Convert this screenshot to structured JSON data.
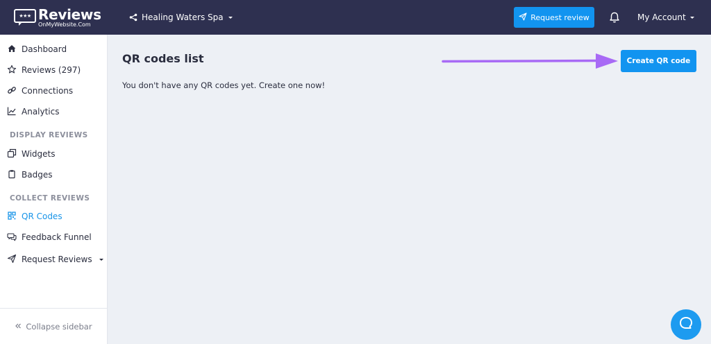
{
  "brand": {
    "title": "Reviews",
    "subtitle": "OnMyWebsite.Com",
    "badge_text": "★★★"
  },
  "header": {
    "location_name": "Healing Waters Spa",
    "request_review_label": "Request review",
    "account_label": "My Account"
  },
  "sidebar": {
    "items": [
      {
        "label": "Dashboard",
        "icon": "home-icon"
      },
      {
        "label": "Reviews (297)",
        "icon": "star-icon"
      },
      {
        "label": "Connections",
        "icon": "link-icon"
      },
      {
        "label": "Analytics",
        "icon": "chart-icon"
      }
    ],
    "display_section": "DISPLAY REVIEWS",
    "display_items": [
      {
        "label": "Widgets",
        "icon": "widgets-icon"
      },
      {
        "label": "Badges",
        "icon": "badge-icon"
      }
    ],
    "collect_section": "COLLECT REVIEWS",
    "collect_items": [
      {
        "label": "QR Codes",
        "icon": "qr-icon",
        "active": true
      },
      {
        "label": "Feedback Funnel",
        "icon": "chat-icon"
      },
      {
        "label": "Request Reviews",
        "icon": "send-icon"
      }
    ],
    "collapse_label": "Collapse sidebar"
  },
  "main": {
    "title": "QR codes list",
    "empty_message": "You don't have any QR codes yet. Create one now!",
    "create_button": "Create QR code"
  },
  "colors": {
    "topbar": "#2e3050",
    "primary": "#1294f0",
    "active_nav": "#1894e8",
    "arrow": "#a86af5",
    "background": "#edf0f5"
  }
}
